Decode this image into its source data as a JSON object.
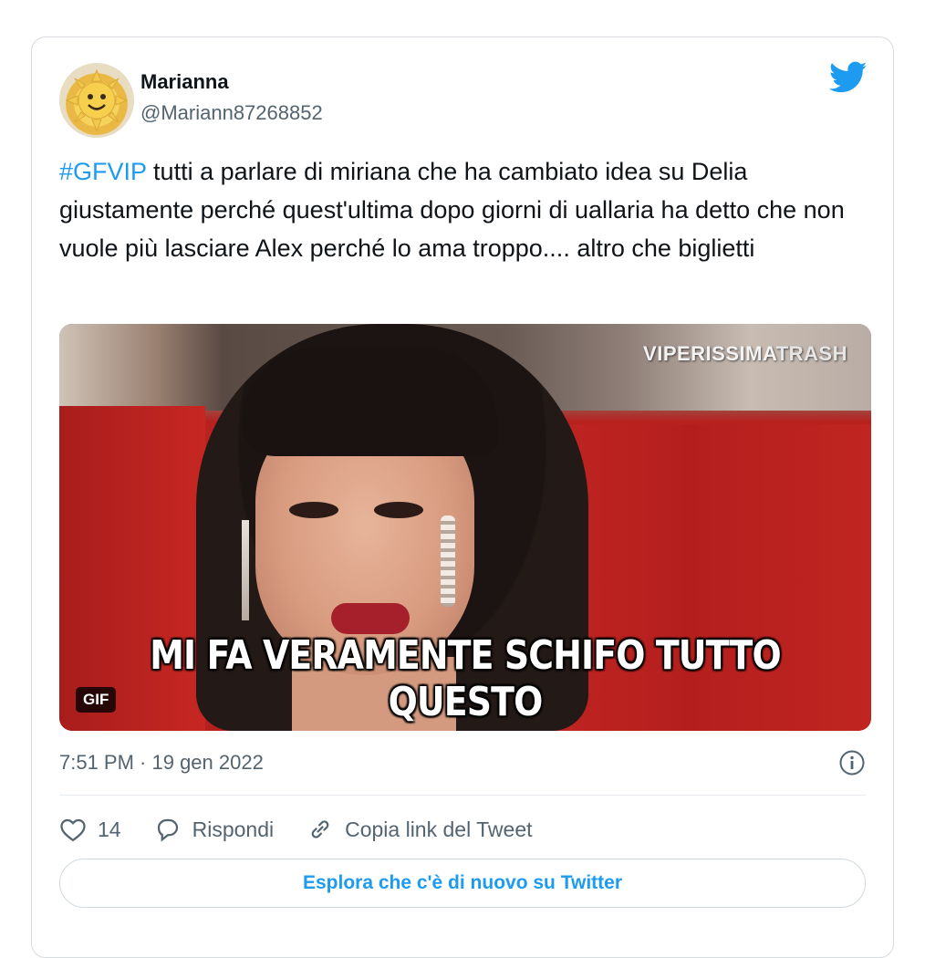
{
  "author": {
    "name": "Marianna",
    "handle": "@Mariann87268852",
    "avatar_icon": "smiling-sun-icon"
  },
  "tweet": {
    "hashtag": "#GFVIP",
    "text": " tutti a parlare di miriana che ha cambiato idea su Delia giustamente perché quest'ultima dopo giorni di uallaria ha detto che non vuole più lasciare Alex perché lo ama troppo.... altro che biglietti"
  },
  "media": {
    "watermark_prefix": "VIPERISSIMA",
    "watermark_suffix": "TRASH",
    "caption": "MI FA VERAMENTE SCHIFO TUTTO QUESTO",
    "badge": "GIF"
  },
  "meta": {
    "timestamp": "7:51 PM · 19 gen 2022"
  },
  "actions": {
    "like_count": "14",
    "reply_label": "Rispondi",
    "copy_link_label": "Copia link del Tweet"
  },
  "explore_label": "Esplora che c'è di nuovo su Twitter",
  "colors": {
    "accent": "#1d9bf0",
    "text": "#0f1419",
    "muted": "#536471"
  }
}
